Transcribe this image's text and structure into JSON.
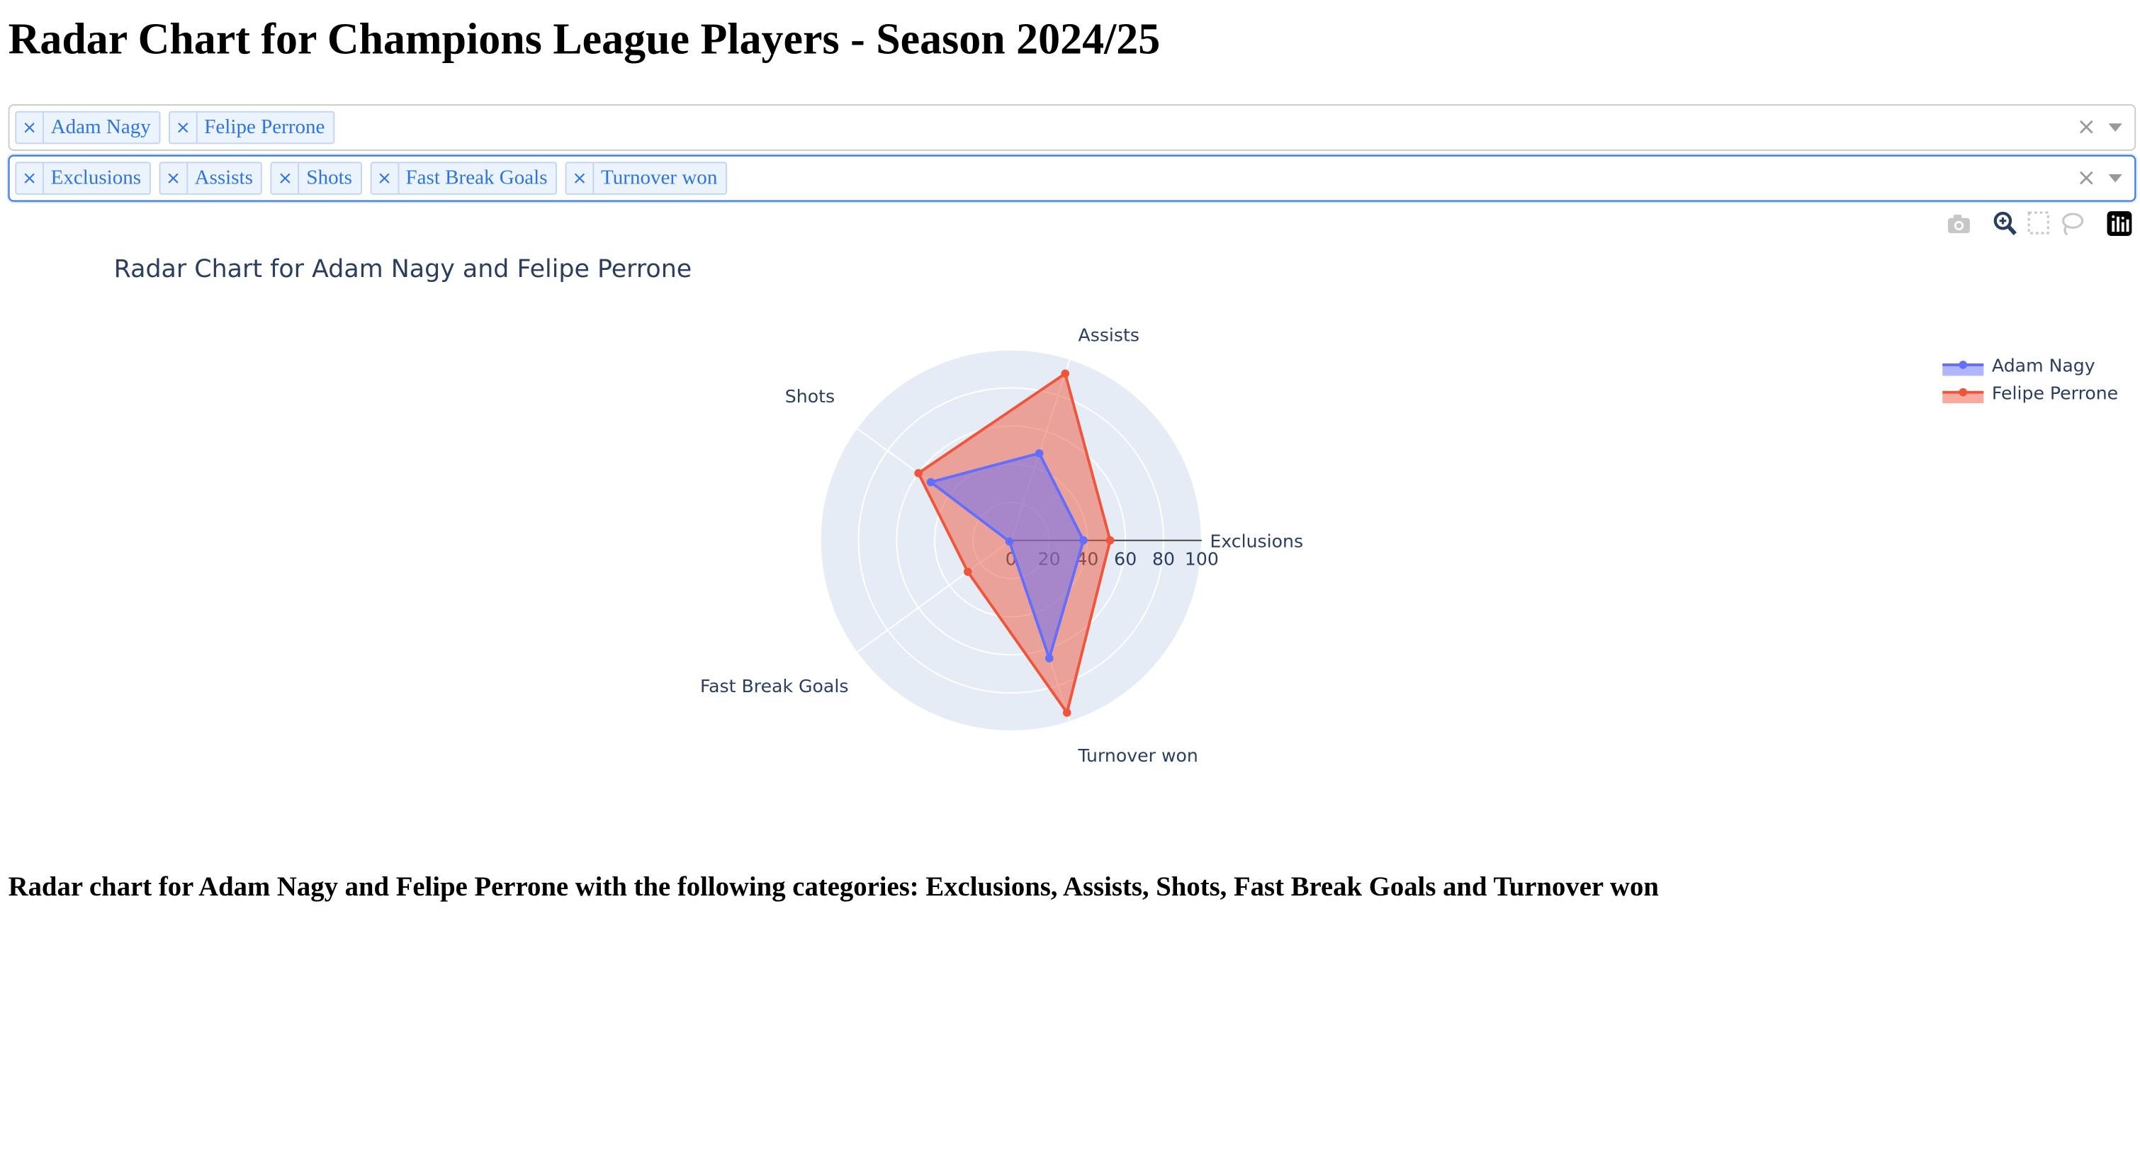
{
  "page": {
    "heading": "Radar Chart for Champions League Players - Season 2024/25",
    "caption": "Radar chart for Adam Nagy and Felipe Perrone with the following categories: Exclusions, Assists, Shots, Fast Break Goals and Turnover won"
  },
  "player_select": {
    "selected": [
      "Adam Nagy",
      "Felipe Perrone"
    ],
    "remove_glyph": "×",
    "clear_glyph": "×"
  },
  "category_select": {
    "selected": [
      "Exclusions",
      "Assists",
      "Shots",
      "Fast Break Goals",
      "Turnover won"
    ],
    "remove_glyph": "×",
    "clear_glyph": "×"
  },
  "modebar": {
    "icons": [
      "camera-icon",
      "zoom-icon",
      "box-select-icon",
      "lasso-select-icon",
      "plotly-logo-icon"
    ]
  },
  "colors": {
    "accent": "#2f74e0",
    "polar_bg": "#e5ecf6",
    "series_1": "#636efa",
    "series_2": "#ef553b"
  },
  "chart_data": {
    "type": "radar",
    "title": "Radar Chart for Adam Nagy and Felipe Perrone",
    "categories": [
      "Exclusions",
      "Assists",
      "Shots",
      "Fast Break Goals",
      "Turnover won"
    ],
    "radial_range": [
      0,
      100
    ],
    "radial_ticks": [
      "0",
      "20",
      "40",
      "60",
      "80",
      "100"
    ],
    "series": [
      {
        "name": "Adam Nagy",
        "values": [
          38,
          48,
          52,
          1,
          65
        ]
      },
      {
        "name": "Felipe Perrone",
        "values": [
          52,
          92,
          60,
          28,
          95
        ]
      }
    ],
    "legend_position": "top-right",
    "grid": true
  }
}
